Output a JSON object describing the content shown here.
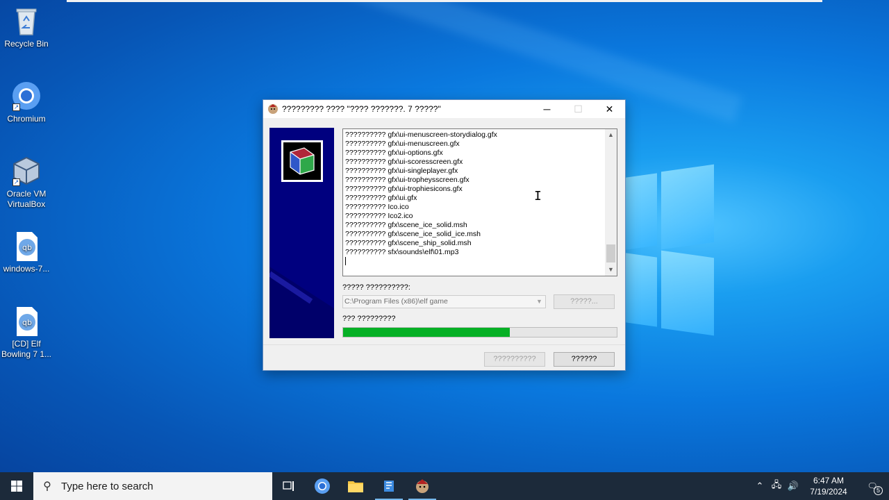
{
  "desktop": {
    "icons": [
      {
        "label": "Recycle Bin"
      },
      {
        "label": "Chromium"
      },
      {
        "label": "Oracle VM VirtualBox"
      },
      {
        "label": "windows-7..."
      },
      {
        "label": "[CD] Elf Bowling 7 1..."
      }
    ]
  },
  "dialog": {
    "title": "????????? ???? \"???? ???????. 7 ?????\"",
    "log_lines": [
      "?????????? gfx\\ui-menuscreen-storydialog.gfx",
      "?????????? gfx\\ui-menuscreen.gfx",
      "?????????? gfx\\ui-options.gfx",
      "?????????? gfx\\ui-scoresscreen.gfx",
      "?????????? gfx\\ui-singleplayer.gfx",
      "?????????? gfx\\ui-tropheysscreen.gfx",
      "?????????? gfx\\ui-trophiesicons.gfx",
      "?????????? gfx\\ui.gfx",
      "?????????? Ico.ico",
      "?????????? Ico2.ico",
      "?????????? gfx\\scene_ice_solid.msh",
      "?????????? gfx\\scene_ice_solid_ice.msh",
      "?????????? gfx\\scene_ship_solid.msh",
      "?????????? sfx\\sounds\\elf\\01.mp3"
    ],
    "folder_label": "????? ??????????:",
    "folder_value": "C:\\Program Files (x86)\\elf game",
    "browse_label": "?????...",
    "progress_label": "??? ?????????",
    "progress_percent": 61,
    "back_label": "??????????",
    "cancel_label": "??????"
  },
  "taskbar": {
    "search_placeholder": "Type here to search",
    "time": "6:47 AM",
    "date": "7/19/2024",
    "notification_count": "5"
  },
  "colors": {
    "progress_fill": "#06b025",
    "banner": "#00007f",
    "taskbar": "#1c2a3a"
  }
}
